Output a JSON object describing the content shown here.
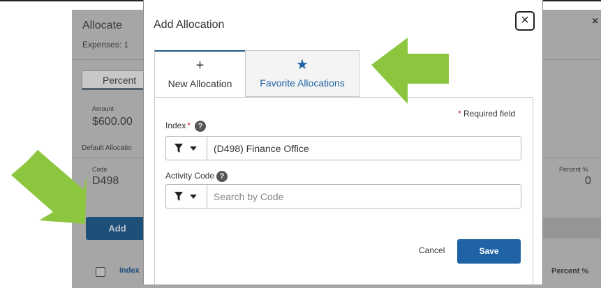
{
  "background": {
    "title": "Allocate",
    "expenses": "Expenses: 1",
    "toggle_label": "Percent",
    "amount_label": "Amount",
    "amount_value": "$600.00",
    "default_allocation": "Default Allocatio",
    "code_label": "Code",
    "code_value": "D498",
    "percent_label": "Percent %",
    "percent_value": "0",
    "add_label": "Add",
    "col_index": "Index",
    "col_percent": "Percent %",
    "close_glyph": "×"
  },
  "modal": {
    "title": "Add Allocation",
    "close_glyph": "×",
    "tabs": [
      {
        "label": "New Allocation",
        "icon": "plus-icon",
        "glyph": "+"
      },
      {
        "label": "Favorite Allocations",
        "icon": "star-icon",
        "glyph": "★"
      }
    ],
    "required_star": "*",
    "required_text": "Required field",
    "index_label": "Index",
    "index_star": "*",
    "help_glyph": "?",
    "index_value": "(D498) Finance Office",
    "activity_label": "Activity Code",
    "activity_placeholder": "Search by Code",
    "cancel_label": "Cancel",
    "save_label": "Save"
  },
  "colors": {
    "primary": "#1f63a6",
    "dark_button": "#1d4f79",
    "overlay": "#a6a6a6",
    "required": "#c0272d",
    "arrow": "#8cc63f"
  }
}
